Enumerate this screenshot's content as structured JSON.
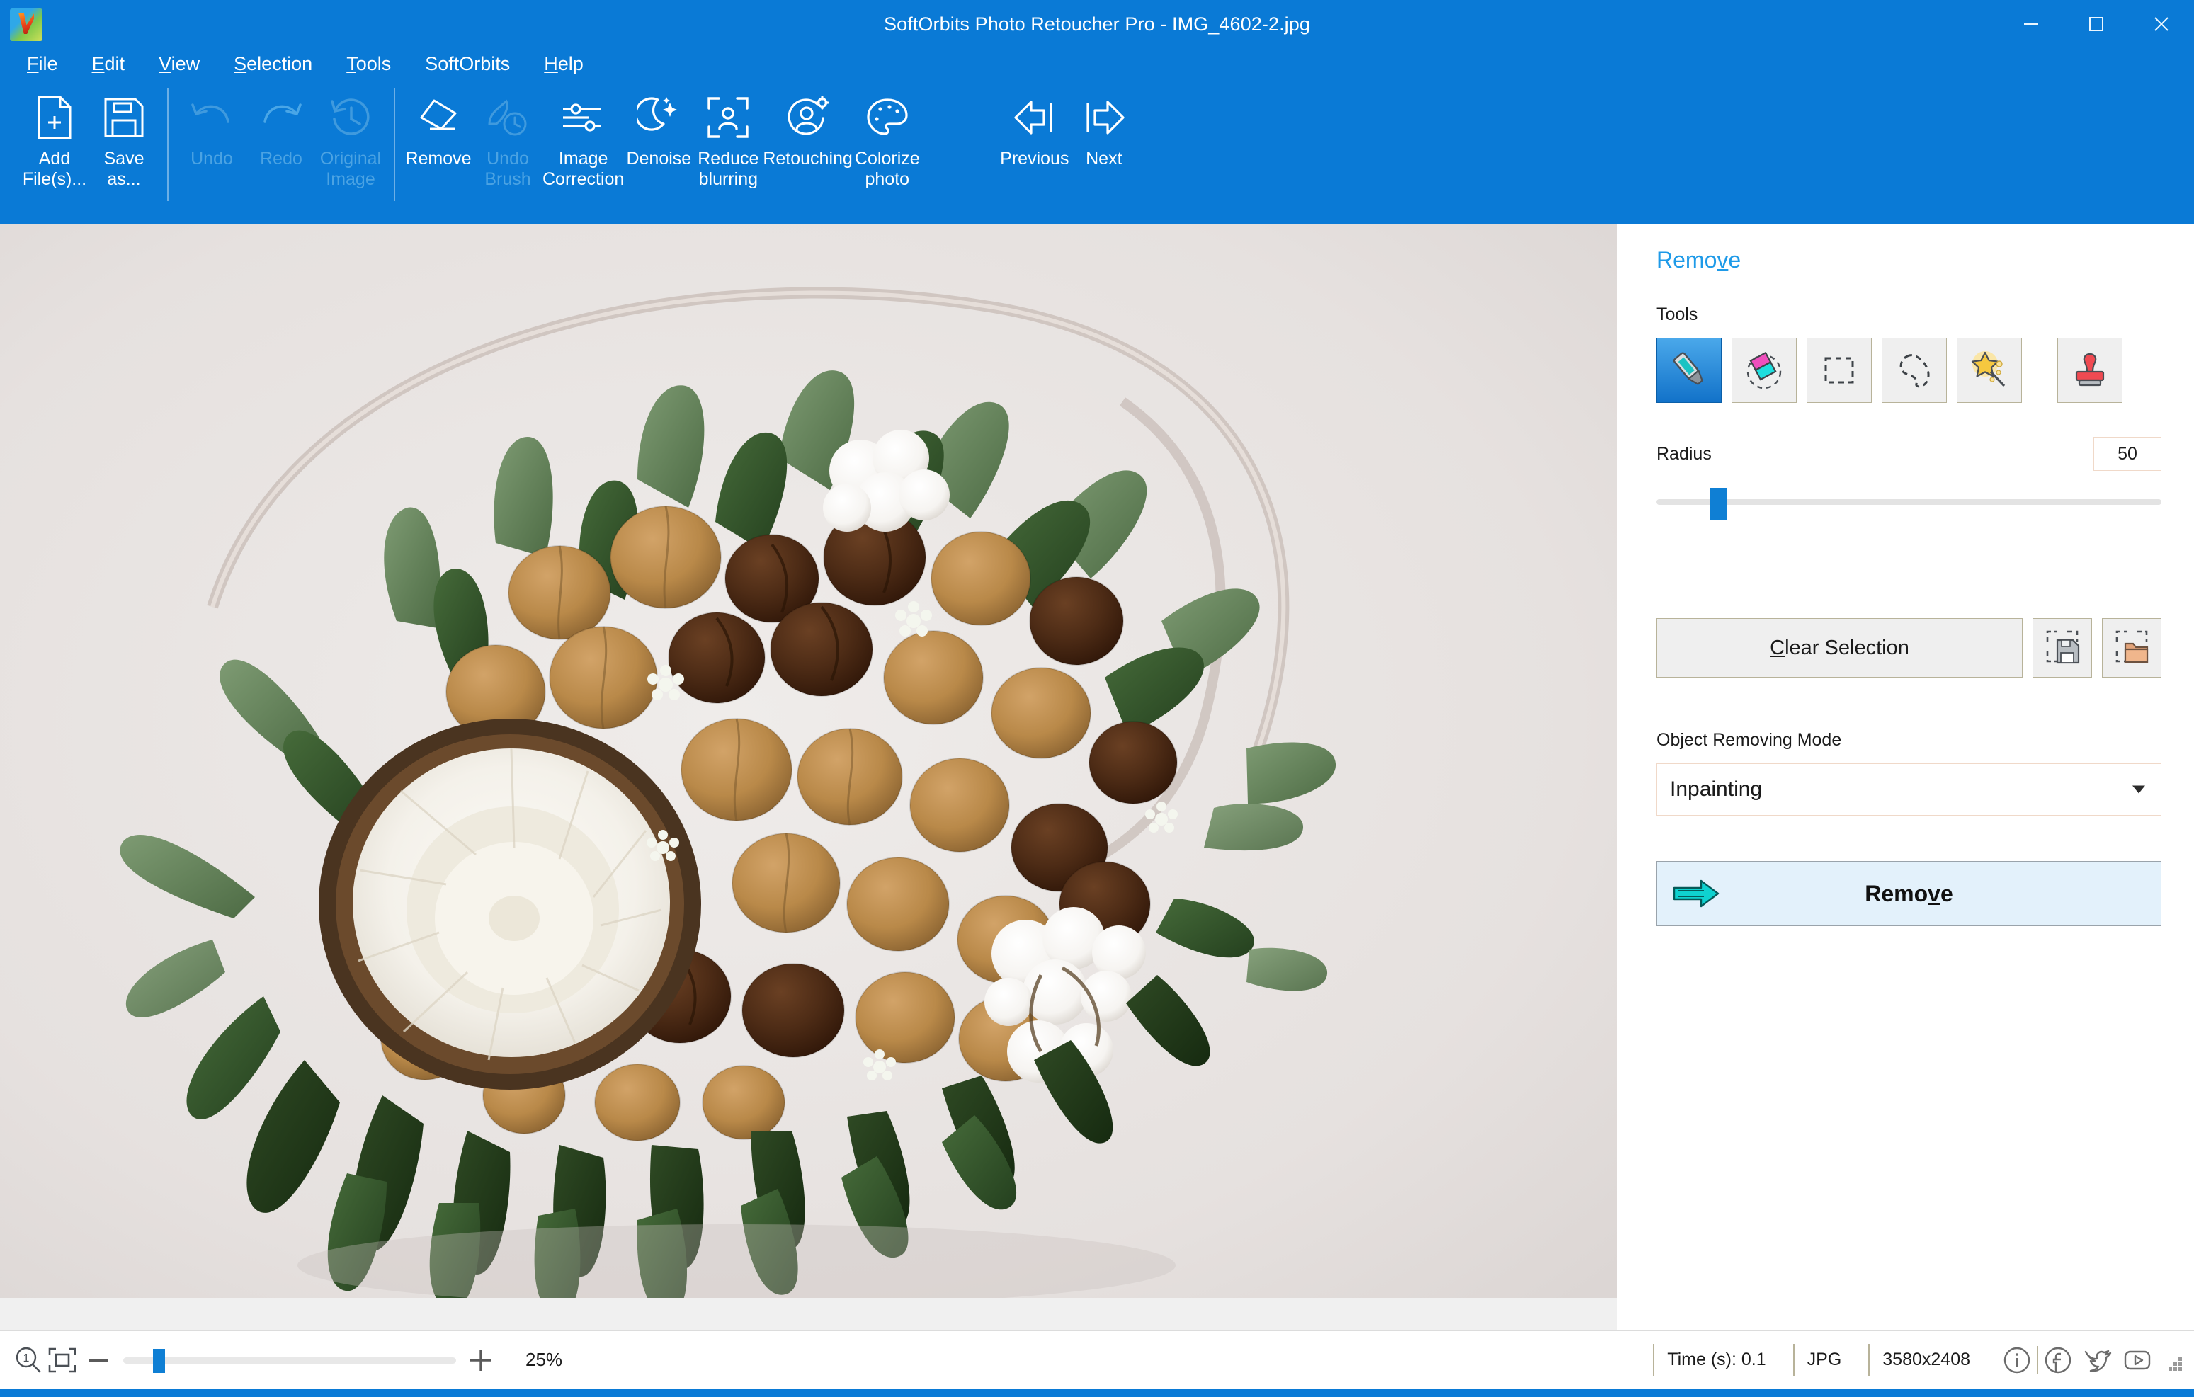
{
  "window": {
    "title": "SoftOrbits Photo Retoucher Pro - IMG_4602-2.jpg",
    "logo_icon": "softorbits-logo-icon",
    "controls": [
      {
        "name": "minimize",
        "icon": "minimize-icon"
      },
      {
        "name": "maximize",
        "icon": "maximize-icon"
      },
      {
        "name": "close",
        "icon": "close-icon"
      }
    ],
    "accent_color": "#0a7ad6"
  },
  "menubar": {
    "items": [
      {
        "pre": "F",
        "post": "ile"
      },
      {
        "pre": "E",
        "post": "dit"
      },
      {
        "pre": "V",
        "post": "iew"
      },
      {
        "pre": "S",
        "post": "election"
      },
      {
        "pre": "T",
        "post": "ools"
      },
      {
        "pre": "",
        "post": "SoftOrbits"
      },
      {
        "pre": "H",
        "post": "elp"
      }
    ]
  },
  "toolbar": {
    "buttons": [
      {
        "id": "add-files",
        "label": "Add\nFile(s)...",
        "icon": "add-file-icon",
        "enabled": true
      },
      {
        "id": "save-as",
        "label": "Save\nas...",
        "icon": "save-disk-icon",
        "enabled": true
      },
      {
        "id": "undo",
        "label": "Undo",
        "icon": "undo-arrow-icon",
        "enabled": false
      },
      {
        "id": "redo",
        "label": "Redo",
        "icon": "redo-arrow-icon",
        "enabled": false
      },
      {
        "id": "original-image",
        "label": "Original\nImage",
        "icon": "history-clock-icon",
        "enabled": false
      },
      {
        "id": "remove",
        "label": "Remove",
        "icon": "eraser-icon",
        "enabled": true
      },
      {
        "id": "undo-brush",
        "label": "Undo\nBrush",
        "icon": "brush-clock-icon",
        "enabled": false
      },
      {
        "id": "image-correction",
        "label": "Image\nCorrection",
        "icon": "sliders-icon",
        "enabled": true
      },
      {
        "id": "denoise",
        "label": "Denoise",
        "icon": "moon-sparkle-icon",
        "enabled": true
      },
      {
        "id": "reduce-blurring",
        "label": "Reduce\nblurring",
        "icon": "focus-person-icon",
        "enabled": true
      },
      {
        "id": "retouching",
        "label": "Retouching",
        "icon": "person-gear-icon",
        "enabled": true
      },
      {
        "id": "colorize-photo",
        "label": "Colorize\nphoto",
        "icon": "palette-icon",
        "enabled": true
      },
      {
        "id": "previous",
        "label": "Previous",
        "icon": "arrow-left-icon",
        "enabled": true
      },
      {
        "id": "next",
        "label": "Next",
        "icon": "arrow-right-icon",
        "enabled": true
      }
    ]
  },
  "sidebar": {
    "panel_title_pre": "Remo",
    "panel_title_u": "v",
    "panel_title_post": "e",
    "tools_label": "Tools",
    "tools": [
      {
        "id": "brush",
        "icon": "marker-brush-icon",
        "selected": true
      },
      {
        "id": "eraser",
        "icon": "eraser-color-icon",
        "selected": false
      },
      {
        "id": "rect-select",
        "icon": "rectangle-select-icon",
        "selected": false
      },
      {
        "id": "lasso-select",
        "icon": "lasso-select-icon",
        "selected": false
      },
      {
        "id": "magic-wand",
        "icon": "magic-wand-icon",
        "selected": false
      },
      {
        "id": "clone-stamp",
        "icon": "clone-stamp-icon",
        "selected": false
      }
    ],
    "radius_label": "Radius",
    "radius_value": "50",
    "radius_percent": 10.5,
    "clear_selection_pre": "C",
    "clear_selection_post": "lear Selection",
    "save_selection_icon": "save-selection-icon",
    "load_selection_icon": "load-selection-icon",
    "mode_label": "Object Removing Mode",
    "mode_value": "Inpainting",
    "mode_options": [
      "Inpainting"
    ],
    "remove_btn_pre": "Remo",
    "remove_btn_u": "v",
    "remove_btn_post": "e",
    "remove_btn_icon": "green-arrow-right-icon"
  },
  "statusbar": {
    "zoom_actual_icon": "zoom-1-1-icon",
    "zoom_fit_icon": "fit-to-screen-icon",
    "minus_icon": "minus-icon",
    "plus_icon": "plus-icon",
    "zoom_percent": "25%",
    "zoom_slider_percent": 9,
    "time_label": "Time (s): 0.1",
    "format_label": "JPG",
    "dimensions_label": "3580x2408",
    "social": [
      {
        "id": "info",
        "icon": "info-circle-icon"
      },
      {
        "id": "facebook",
        "icon": "facebook-icon"
      },
      {
        "id": "twitter",
        "icon": "twitter-bird-icon"
      },
      {
        "id": "youtube",
        "icon": "youtube-icon"
      }
    ]
  },
  "canvas": {
    "image_name": "nut-and-coconut-bouquet-photo",
    "background_color": "#e6e2e0"
  }
}
